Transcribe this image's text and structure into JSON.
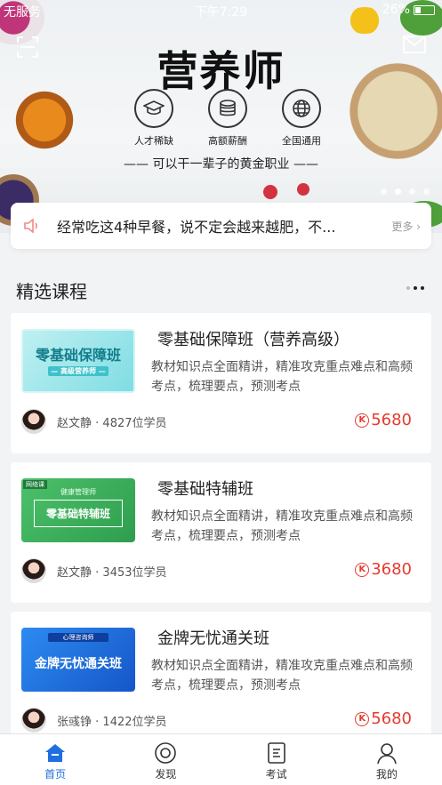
{
  "status_bar": {
    "carrier": "无服务",
    "time": "下午7:29",
    "battery": "26%"
  },
  "banner": {
    "title": "营养师",
    "features": [
      {
        "label": "人才稀缺",
        "icon": "graduation-cap-icon"
      },
      {
        "label": "高额薪酬",
        "icon": "coins-icon"
      },
      {
        "label": "全国通用",
        "icon": "globe-icon"
      }
    ],
    "slogan": "—— 可以干一辈子的黄金职业 ——"
  },
  "notice": {
    "text": "经常吃这4种早餐，说不定会越来越肥，不...",
    "more": "更多 ›"
  },
  "section": {
    "title": "精选课程"
  },
  "courses": [
    {
      "title": "零基础保障班（营养高级）",
      "thumb_title": "零基础保障班",
      "thumb_sub": "— 高级营养师 —",
      "desc": "教材知识点全面精讲，精准攻克重点难点和高频考点，梳理要点，预测考点",
      "teacher": "赵文静",
      "students": "4827位学员",
      "price": "5680"
    },
    {
      "title": "零基础特辅班",
      "thumb_title": "零基础特辅班",
      "thumb_tag": "网络课",
      "thumb_sub": "健康管理师",
      "desc": "教材知识点全面精讲，精准攻克重点难点和高频考点，梳理要点，预测考点",
      "teacher": "赵文静",
      "students": "3453位学员",
      "price": "3680"
    },
    {
      "title": "金牌无忧通关班",
      "thumb_title": "金牌无忧通关班",
      "thumb_sub": "心理咨询师",
      "desc": "教材知识点全面精讲，精准攻克重点难点和高频考点，梳理要点，预测考点",
      "teacher": "张彧铮",
      "students": "1422位学员",
      "price": "5680"
    }
  ],
  "tabs": [
    {
      "label": "首页",
      "icon": "home-icon",
      "active": true
    },
    {
      "label": "发现",
      "icon": "compass-icon"
    },
    {
      "label": "考试",
      "icon": "exam-icon"
    },
    {
      "label": "我的",
      "icon": "user-icon"
    }
  ],
  "colors": {
    "accent": "#1f6fe0",
    "price": "#e63b2e"
  }
}
